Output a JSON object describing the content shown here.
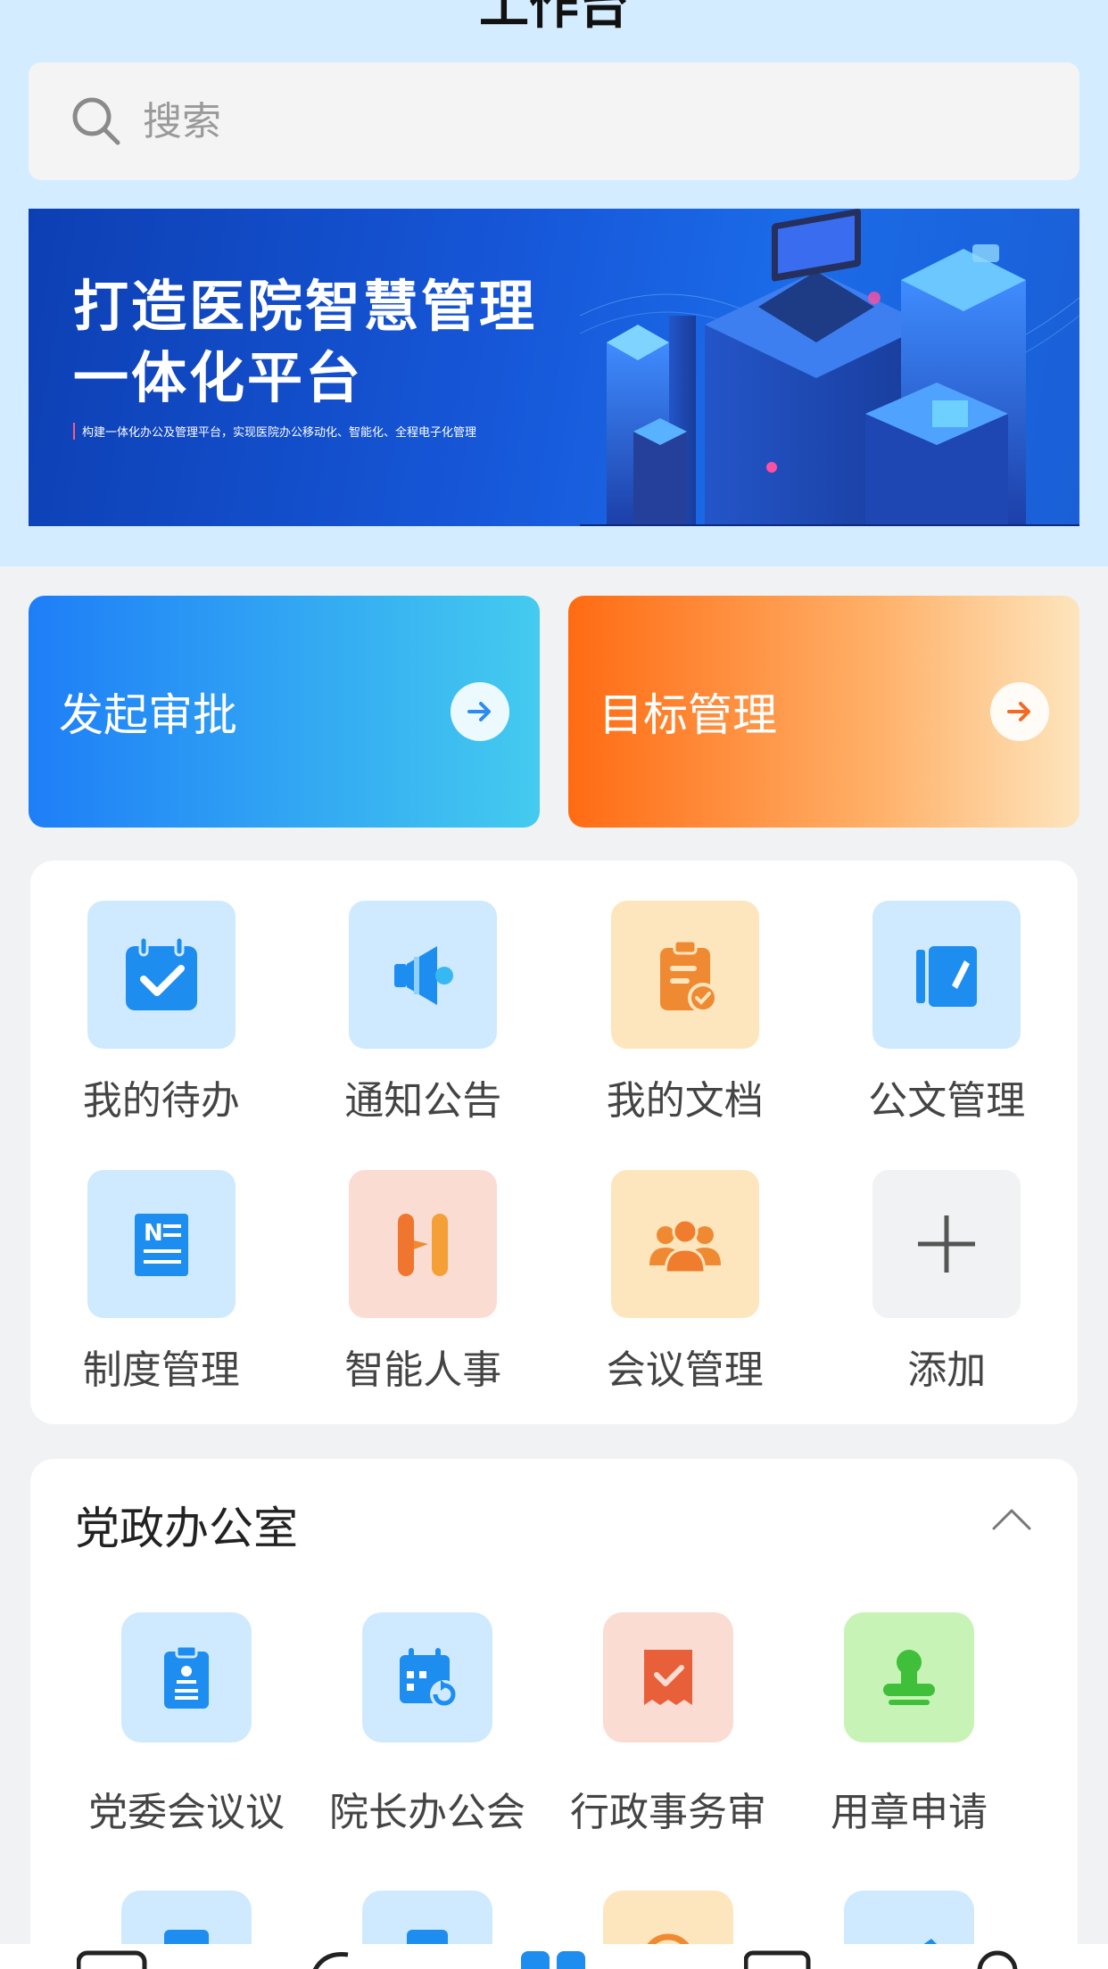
{
  "header": {
    "title": "工作台"
  },
  "search": {
    "placeholder": "搜索"
  },
  "banner": {
    "title_line1": "打造医院智慧管理",
    "title_line2": "一体化平台",
    "subtitle": "构建一体化办公及管理平台，实现医院办公移动化、智能化、全程电子化管理"
  },
  "quick_cards": {
    "approve": "发起审批",
    "target": "目标管理"
  },
  "apps": [
    {
      "label": "我的待办",
      "icon": "calendar-check-icon"
    },
    {
      "label": "通知公告",
      "icon": "megaphone-icon"
    },
    {
      "label": "我的文档",
      "icon": "clipboard-check-icon"
    },
    {
      "label": "公文管理",
      "icon": "folder-pen-icon"
    },
    {
      "label": "制度管理",
      "icon": "document-n-icon"
    },
    {
      "label": "智能人事",
      "icon": "hr-h-icon"
    },
    {
      "label": "会议管理",
      "icon": "people-group-icon"
    },
    {
      "label": "添加",
      "icon": "plus-icon"
    }
  ],
  "office": {
    "title": "党政办公室",
    "items": [
      {
        "label": "党委会议议",
        "icon": "clipboard-people-icon"
      },
      {
        "label": "院长办公会",
        "icon": "calendar-refresh-icon"
      },
      {
        "label": "行政事务审",
        "icon": "receipt-check-icon"
      },
      {
        "label": "用章申请",
        "icon": "stamp-icon"
      }
    ]
  },
  "colors": {
    "top_bg": "#d3ecff",
    "approve_gradient_start": "#1e7ef7",
    "target_gradient_start": "#ff6b12",
    "icon_blue": "#1d8df0",
    "icon_orange": "#ef8a33"
  }
}
